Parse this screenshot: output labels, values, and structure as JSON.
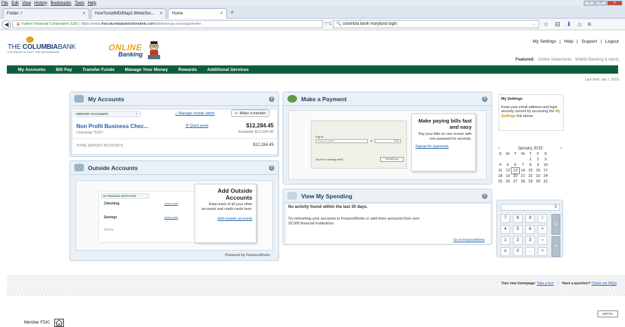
{
  "browser": {
    "menu": [
      "File",
      "Edit",
      "View",
      "History",
      "Bookmarks",
      "Tools",
      "Help"
    ],
    "window_buttons": [
      "–",
      "□",
      "✕"
    ],
    "tabs": [
      {
        "label": "Folder: /",
        "close": "×"
      },
      {
        "label": "HowToAddMDIMap2.8WebSer...",
        "close": "×"
      },
      {
        "label": "Home",
        "close": "×"
      }
    ],
    "new_tab": "+",
    "back": "◀",
    "site_identity": "Fulton Financial Corporation (US)",
    "url_prefix": "https://www.",
    "url_domain": "thecolumbiabankonlinebnk.com",
    "url_rest": "/tob/live/usp-core/app/home",
    "url_icons": "▽ C",
    "search_value": "columbia bank maryland login",
    "search_go": "→",
    "toolbar_icons": [
      "☆",
      "⊟",
      "⬇",
      "⌂",
      "≡"
    ]
  },
  "header": {
    "logo_prefix": "THE ",
    "logo_main": "COLUMBIA",
    "logo_suffix": "BANK",
    "tagline": "LISTENING IS JUST THE BEGINNING®",
    "online": "ONLINE",
    "banking": "Banking",
    "top_links": [
      "My Settings",
      "|",
      "Help",
      "|",
      "Support",
      "|",
      "Logout"
    ],
    "featured_label": "Featured:",
    "featured_links": [
      "Online Statements",
      "Mobile Banking & Alerts"
    ]
  },
  "nav": [
    "My Accounts",
    "Bill Pay",
    "Transfer Funds",
    "Manage Your Money",
    "Rewards",
    "Additional Services"
  ],
  "last_visit": "Last Visit: Jan 7, 2015",
  "my_accounts": {
    "title": "My Accounts",
    "help": "?",
    "tab_label": "DEPOSIT ACCOUNTS",
    "manage_alerts": "Manage mobile alerts",
    "transfer_btn": "Make a transfer",
    "account_name": "Non Profit Business Chec...",
    "account_sub": "Checking *9157",
    "quick_peek": "Quick peek",
    "balance": "$12,284.45",
    "available": "Available $12,284.45",
    "total_label": "TOTAL DEPOSIT ACCOUNTS",
    "total_value": "$12,284.45"
  },
  "outside": {
    "title": "Outside Accounts",
    "help": "?",
    "inst_label": "MY FINANCIAL INSTITUTION",
    "rows": [
      {
        "name": "Checking",
        "link": "Quick peek"
      },
      {
        "name": "Savings",
        "link": "Quick peek"
      },
      {
        "name": "TOTAL",
        "link": ""
      }
    ],
    "promo_title": "Add Outside Accounts",
    "promo_text": "Keep track of all your other accounts and credit cards here.",
    "promo_link": "Add outside accounts",
    "powered": "Powered by FinanceWorks"
  },
  "payment": {
    "title": "Make a Payment",
    "help": "?",
    "pay_to": "Pay to",
    "search_payee": "Search a payee",
    "amount": "$",
    "amount_val": "0.00",
    "pay_from": "Pay from: checking x4087",
    "schedule": "Schedule pay",
    "promo_title": "Make paying bills fast and easy",
    "promo_text": "Pay your bills on one screen with one password in seconds.",
    "promo_link": "Signup for payments"
  },
  "spending": {
    "title": "View My Spending",
    "help": "?",
    "line1": "No activity found within the last 30 days.",
    "line2": "Try refreshing your accounts in FinanceWorks or add more accounts from over 18,000 financial institutions.",
    "link": "Go to FinanceWorks"
  },
  "settings_box": {
    "title": "My Settings",
    "text_a": "Keep your email address and login security current by accessing the ",
    "link": "My Settings",
    "text_b": " link above."
  },
  "calendar": {
    "month": "January 2015",
    "prev": "‹",
    "next": "›",
    "days": [
      "S",
      "M",
      "T",
      "W",
      "T",
      "F",
      "S"
    ],
    "dates": [
      "",
      "",
      "",
      "",
      "1",
      "2",
      "3",
      "4",
      "5",
      "6",
      "7",
      "8",
      "9",
      "10",
      "11",
      "12",
      "13",
      "14",
      "15",
      "16",
      "17",
      "18",
      "19",
      "20",
      "21",
      "22",
      "23",
      "24",
      "25",
      "26",
      "27",
      "28",
      "29",
      "30",
      "31"
    ],
    "today": "13"
  },
  "calculator": {
    "display": "0",
    "keys": [
      [
        "7",
        "8",
        "9",
        "/"
      ],
      [
        "4",
        "5",
        "6",
        "×"
      ],
      [
        "1",
        "2",
        "3",
        "–"
      ],
      [
        "±",
        "0",
        ".",
        "+"
      ]
    ],
    "clear": "C",
    "equals": "="
  },
  "bottom": {
    "homepage_label": "Your new homepage:",
    "tour": "Take a tour",
    "sep": "|",
    "question": "Have a question?",
    "faq": "Check our FAQs"
  },
  "footer": {
    "fdic": "Member FDIC",
    "fdic_icon": "EQUAL HOUSING",
    "digital": "DIGITAL"
  },
  "colors": {
    "nav_green": "#0e5e3a",
    "brand_blue": "#1a3f7a",
    "accent_gold": "#e8a21c",
    "link_blue": "#1d62b6"
  }
}
